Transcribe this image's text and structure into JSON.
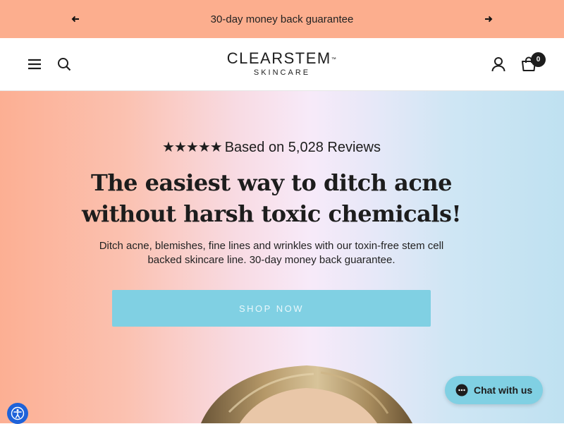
{
  "announcement": {
    "text": "30-day money back guarantee",
    "prev_icon": "arrow-left-icon",
    "next_icon": "arrow-right-icon",
    "background": "#fcae8e"
  },
  "header": {
    "logo": {
      "main": "CLEARSTEM",
      "tm": "™",
      "sub": "SKINCARE"
    },
    "cart_count": "0",
    "icons": [
      "menu-icon",
      "search-icon",
      "account-icon",
      "cart-icon"
    ]
  },
  "hero": {
    "stars": "★★★★★",
    "rating_text": "Based on 5,028 Reviews",
    "headline": "The easiest way to ditch acne without harsh toxic chemicals!",
    "subtext": "Ditch acne, blemishes, fine lines and wrinkles with our toxin-free stem cell backed skincare line. 30-day money back guarantee.",
    "cta_label": "SHOP NOW",
    "cta_color": "#80d0e3"
  },
  "chat": {
    "label": "Chat with us",
    "icon": "chat-bubble-icon"
  },
  "accessibility": {
    "icon": "accessibility-icon",
    "color": "#1e62d9"
  }
}
